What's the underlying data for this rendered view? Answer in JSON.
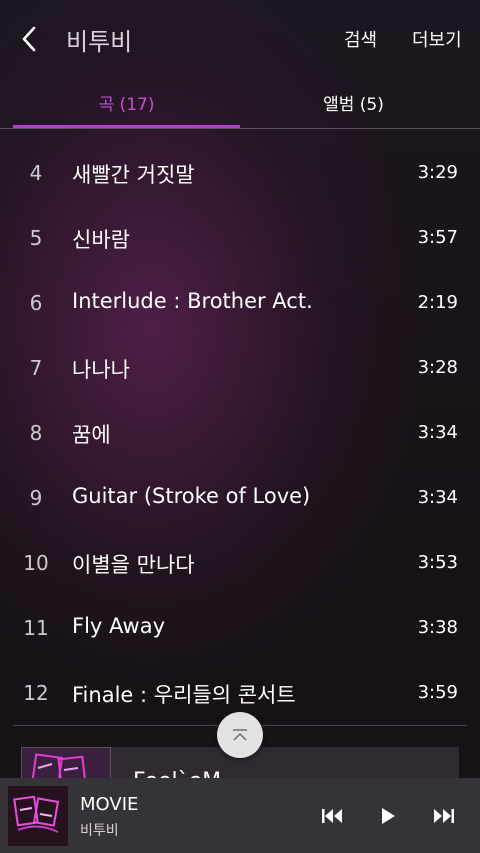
{
  "header": {
    "title": "비투비",
    "search_label": "검색",
    "more_label": "더보기"
  },
  "tabs": [
    {
      "label": "곡 (17)",
      "active": true
    },
    {
      "label": "앨범 (5)",
      "active": false
    }
  ],
  "tracks": [
    {
      "num": "4",
      "title": "새빨간 거짓말",
      "duration": "3:29"
    },
    {
      "num": "5",
      "title": "신바람",
      "duration": "3:57"
    },
    {
      "num": "6",
      "title": "Interlude : Brother Act.",
      "duration": "2:19"
    },
    {
      "num": "7",
      "title": "나나나",
      "duration": "3:28"
    },
    {
      "num": "8",
      "title": "꿈에",
      "duration": "3:34"
    },
    {
      "num": "9",
      "title": "Guitar (Stroke of Love)",
      "duration": "3:34"
    },
    {
      "num": "10",
      "title": "이별을 만나다",
      "duration": "3:53"
    },
    {
      "num": "11",
      "title": "Fly Away",
      "duration": "3:38"
    },
    {
      "num": "12",
      "title": "Finale : 우리들의 콘서트",
      "duration": "3:59"
    }
  ],
  "album_peek": {
    "title": "Feel`eM"
  },
  "mini_player": {
    "song": "MOVIE",
    "artist": "비투비"
  },
  "colors": {
    "accent": "#b43fcf",
    "background": "#1a1319",
    "mini_player_bg": "#353337"
  },
  "icons": {
    "back": "chevron-left-icon",
    "scroll_top": "chevron-up-icon",
    "prev": "skip-previous-icon",
    "play": "play-icon",
    "next": "skip-next-icon"
  }
}
